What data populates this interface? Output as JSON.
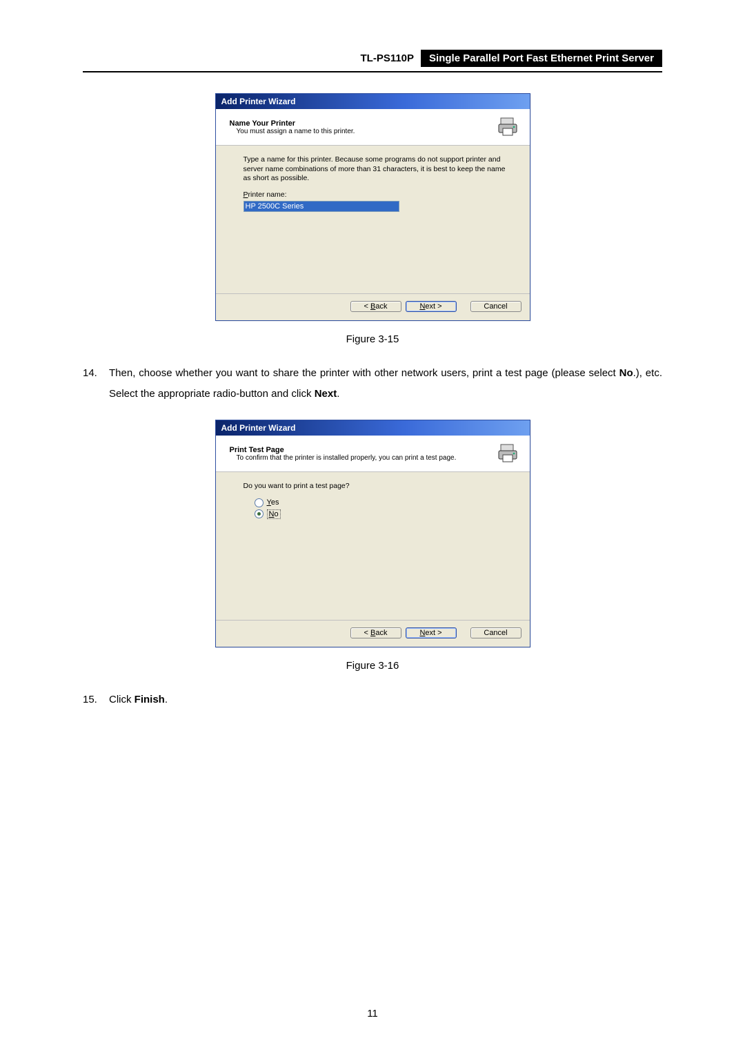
{
  "header": {
    "model": "TL-PS110P",
    "product_desc": "Single Parallel Port Fast Ethernet Print Server"
  },
  "figure15_caption": "Figure 3-15",
  "figure16_caption": "Figure 3-16",
  "step14": {
    "num": "14.",
    "pre": "Then, choose whether you want to share the printer with other network users, print a test page (please select ",
    "bold1": "No",
    "mid": ".), etc. Select the appropriate radio-button and click ",
    "bold2": "Next",
    "post": "."
  },
  "step15": {
    "num": "15.",
    "pre": "Click ",
    "bold1": "Finish",
    "post": "."
  },
  "wizard1": {
    "titlebar": "Add Printer Wizard",
    "header_title": "Name Your Printer",
    "header_sub": "You must assign a name to this printer.",
    "body_paragraph": "Type a name for this printer. Because some programs do not support printer and server name combinations of more than 31 characters, it is best to keep the name as short as possible.",
    "label_prefix": "P",
    "label_rest": "rinter name:",
    "input_value": "HP 2500C Series"
  },
  "wizard2": {
    "titlebar": "Add Printer Wizard",
    "header_title": "Print Test Page",
    "header_sub": "To confirm that the printer is installed properly, you can print a test page.",
    "question": "Do you want to print a test page?",
    "yes_u": "Y",
    "yes_rest": "es",
    "no_u": "N",
    "no_rest": "o"
  },
  "buttons": {
    "back_u": "B",
    "back_rest": "ack",
    "back_prefix": "< ",
    "next_u": "N",
    "next_rest": "ext >",
    "cancel": "Cancel"
  },
  "page_number": "11"
}
